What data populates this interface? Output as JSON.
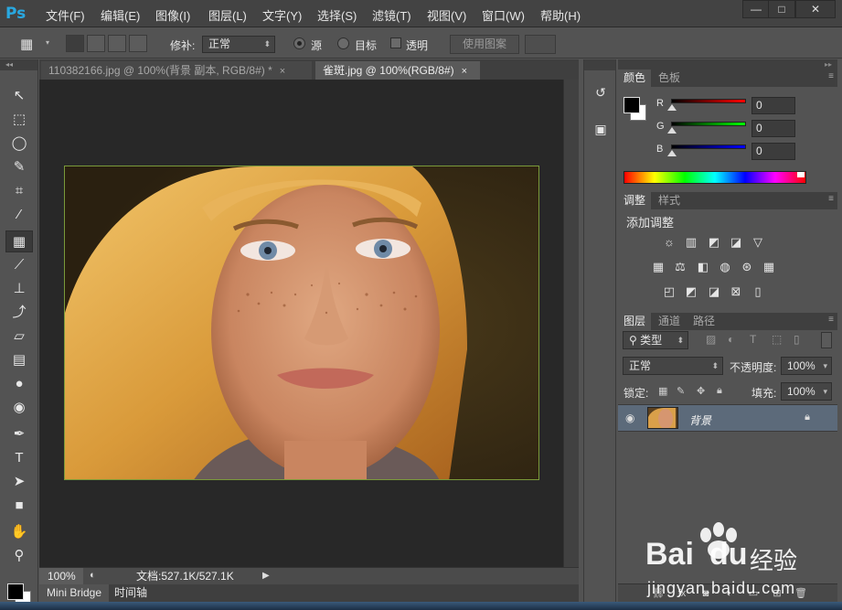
{
  "app": {
    "logo": "Ps"
  },
  "menubar": {
    "items": [
      "文件(F)",
      "编辑(E)",
      "图像(I)",
      "图层(L)",
      "文字(Y)",
      "选择(S)",
      "滤镜(T)",
      "视图(V)",
      "窗口(W)",
      "帮助(H)"
    ],
    "window_controls": [
      "—",
      "□",
      "✕"
    ]
  },
  "options": {
    "patch_label": "修补:",
    "patch_mode": "正常",
    "source_label": "源",
    "target_label": "目标",
    "transparent_label": "透明",
    "use_pattern_label": "使用图案",
    "source_selected": true,
    "target_selected": false,
    "transparent_checked": false
  },
  "tabs": [
    {
      "label": "110382166.jpg @ 100%(背景 副本, RGB/8#) *",
      "close": "×",
      "active": false
    },
    {
      "label": "雀斑.jpg @ 100%(RGB/8#)",
      "close": "×",
      "active": true
    }
  ],
  "status": {
    "zoom": "100%",
    "doc_info": "文档:527.1K/527.1K"
  },
  "bottom_tabs": [
    "Mini Bridge",
    "时间轴"
  ],
  "color_panel": {
    "tabs": [
      "颜色",
      "色板"
    ],
    "channels": [
      {
        "label": "R",
        "value": "0",
        "color": "#ff0000"
      },
      {
        "label": "G",
        "value": "0",
        "color": "#00ff00"
      },
      {
        "label": "B",
        "value": "0",
        "color": "#0000ff"
      }
    ],
    "foreground": "#000000",
    "background": "#ffffff"
  },
  "adjust_panel": {
    "tabs": [
      "调整",
      "样式"
    ],
    "title": "添加调整",
    "rows": [
      [
        "brightness-icon",
        "levels-icon",
        "curves-icon",
        "exposure-icon",
        "vibrance-icon"
      ],
      [
        "hue-saturation-icon",
        "color-balance-icon",
        "black-white-icon",
        "photo-filter-icon",
        "channel-mixer-icon",
        "color-lookup-icon"
      ],
      [
        "invert-icon",
        "posterize-icon",
        "threshold-icon",
        "selective-color-icon",
        "gradient-map-icon"
      ]
    ]
  },
  "layers_panel": {
    "tabs": [
      "图层",
      "通道",
      "路径"
    ],
    "filter_kind": "类型",
    "blend_mode": "正常",
    "opacity_label": "不透明度:",
    "opacity": "100%",
    "lock_label": "锁定:",
    "fill_label": "填充:",
    "fill": "100%",
    "layers": [
      {
        "name": "背景",
        "visible": true,
        "locked": true
      }
    ]
  },
  "watermark": {
    "brand": "Bai",
    "brand2": "du",
    "cn": "经验",
    "url": "jingyan.baidu.com"
  }
}
